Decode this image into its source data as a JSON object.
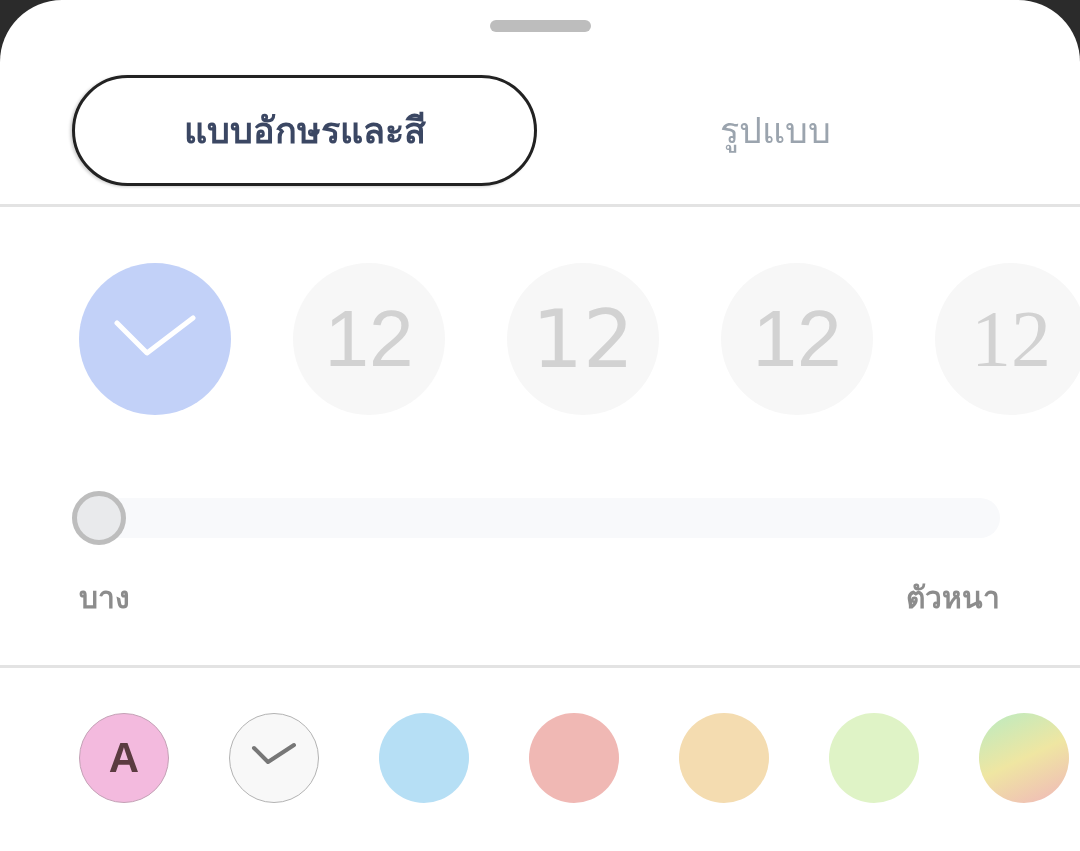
{
  "tabs": [
    {
      "label": "แบบอักษรและสี",
      "selected": true
    },
    {
      "label": "รูปแบบ",
      "selected": false
    }
  ],
  "font_styles": [
    {
      "selected": true
    },
    {
      "label": "12",
      "selected": false
    },
    {
      "label": "12",
      "selected": false
    },
    {
      "label": "12",
      "selected": false
    },
    {
      "label": "12",
      "selected": false
    }
  ],
  "weight_slider": {
    "level": 0,
    "min_label": "บาง",
    "max_label": "ตัวหนา"
  },
  "colors": [
    {
      "kind": "letter",
      "label": "A",
      "color": "#f3bade",
      "selected": false
    },
    {
      "kind": "outlined",
      "color": "#f8f8f8",
      "selected": true
    },
    {
      "kind": "solid",
      "color": "#b6dff5",
      "selected": false
    },
    {
      "kind": "solid",
      "color": "#f0b8b4",
      "selected": false
    },
    {
      "kind": "solid",
      "color": "#f4dcb0",
      "selected": false
    },
    {
      "kind": "solid",
      "color": "#dff3c6",
      "selected": false
    },
    {
      "kind": "gradient",
      "selected": false
    }
  ]
}
